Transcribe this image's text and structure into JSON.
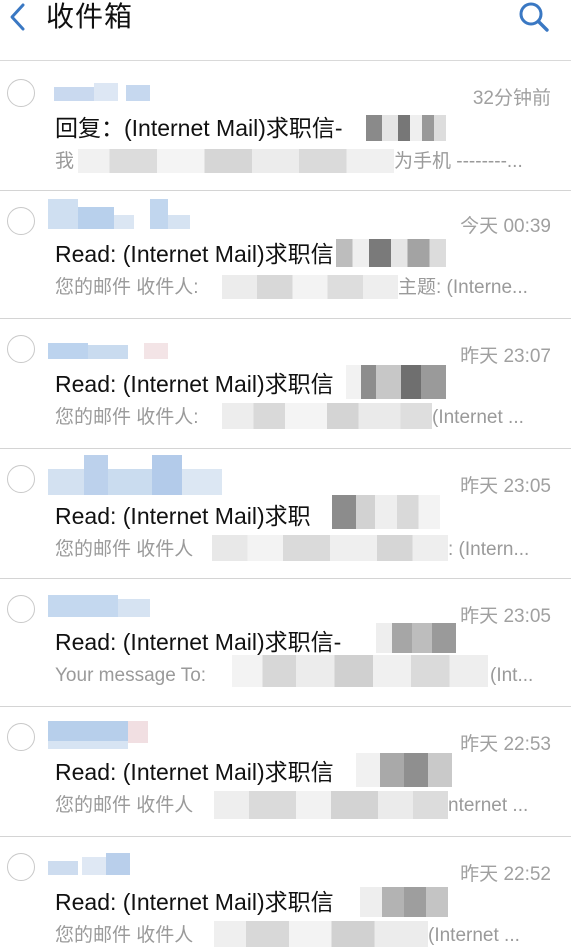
{
  "header": {
    "title": "收件箱",
    "back_icon": "chevron-left-icon",
    "search_icon": "search-icon",
    "accent": "#3a78c3"
  },
  "emails": [
    {
      "time": "32分钟前",
      "subject": "回复：(Internet Mail)求职信-",
      "subject_tail": "",
      "preview": "我",
      "preview_tail": "为手机 --------..."
    },
    {
      "time": "今天 00:39",
      "subject": "Read: (Internet Mail)求职信",
      "subject_tail": "",
      "preview": "您的邮件 收件人:",
      "preview_tail": "主题: (Interne..."
    },
    {
      "time": "昨天 23:07",
      "subject": "Read: (Internet Mail)求职信",
      "subject_tail": "",
      "preview": "您的邮件 收件人:",
      "preview_tail": "(Internet ..."
    },
    {
      "time": "昨天 23:05",
      "subject": "Read: (Internet Mail)求职",
      "subject_tail": "",
      "preview": "您的邮件 收件人",
      "preview_tail": ": (Intern..."
    },
    {
      "time": "昨天 23:05",
      "subject": "Read: (Internet Mail)求职信-",
      "subject_tail": "",
      "preview": "Your message To:",
      "preview_tail": "(Int..."
    },
    {
      "time": "昨天 22:53",
      "subject": "Read: (Internet Mail)求职信",
      "subject_tail": "",
      "preview": "您的邮件 收件人",
      "preview_tail": "nternet ..."
    },
    {
      "time": "昨天 22:52",
      "subject": "Read: (Internet Mail)求职信",
      "subject_tail": "",
      "preview": "您的邮件 收件人",
      "preview_tail": "(Internet ..."
    }
  ]
}
